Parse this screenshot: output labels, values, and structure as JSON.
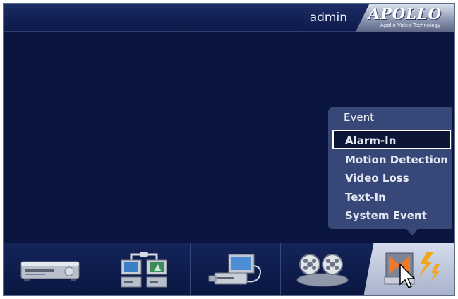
{
  "header": {
    "username": "admin",
    "logo_text": "APOLLO",
    "logo_subtitle": "Apollo Video Technology"
  },
  "event_menu": {
    "title": "Event",
    "items": [
      {
        "label": "Alarm-In",
        "selected": true
      },
      {
        "label": "Motion Detection",
        "selected": false
      },
      {
        "label": "Video Loss",
        "selected": false
      },
      {
        "label": "Text-In",
        "selected": false
      },
      {
        "label": "System Event",
        "selected": false
      }
    ]
  },
  "dock": {
    "items": [
      {
        "icon": "dvr-recorder-icon"
      },
      {
        "icon": "camera-monitors-icon"
      },
      {
        "icon": "computer-network-icon"
      },
      {
        "icon": "film-reels-icon"
      },
      {
        "icon": "event-alarm-icon",
        "active": true
      }
    ]
  },
  "colors": {
    "background": "#0a1640",
    "panel": "#374777",
    "selected_outline": "#ffffff",
    "lightning": "#f2a71b"
  }
}
